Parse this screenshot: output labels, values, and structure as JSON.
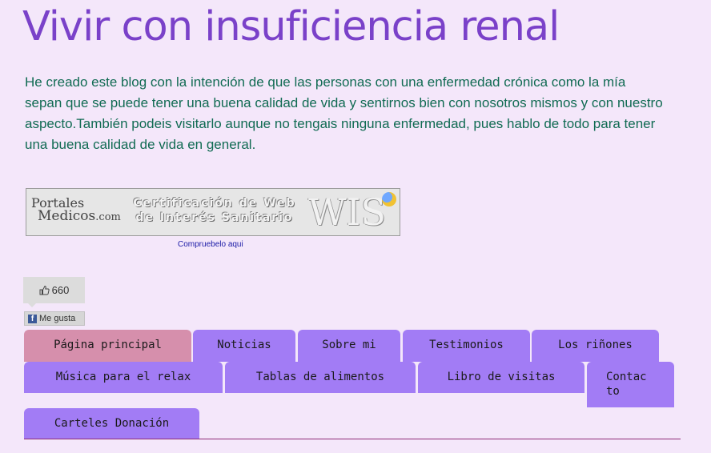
{
  "header": {
    "title": "Vivir con insuficiencia renal"
  },
  "description": "He creado este blog con la intención de que las personas con una enfermedad crónica como la mía sepan que se puede tener una buena calidad de vida y sentirnos bien con nosotros mismos y con nuestro aspecto.También podeis visitarlo aunque no tengais ninguna enfermedad, pues hablo de todo para tener una buena calidad de vida en general.",
  "badge": {
    "logo_line1": "Portales",
    "logo_line2": "Medicos",
    "logo_suffix": ".com",
    "cert_line1": "Certificación de Web",
    "cert_line2": "de Interés Sanitario",
    "wis": "WIS",
    "check_link": "Compruebelo aqui"
  },
  "like": {
    "count": "660",
    "button_label": "Me gusta",
    "fb_letter": "f"
  },
  "nav": {
    "tabs": [
      {
        "label": "Página principal",
        "active": true
      },
      {
        "label": "Noticias"
      },
      {
        "label": "Sobre mi"
      },
      {
        "label": "Testimonios"
      },
      {
        "label": "Los riñones"
      },
      {
        "label": "Música para el relax"
      },
      {
        "label": "Tablas de alimentos"
      },
      {
        "label": "Libro de visitas"
      },
      {
        "label": "Contac to"
      },
      {
        "label": "Carteles Donación"
      }
    ]
  },
  "colors": {
    "background": "#f4e7fa",
    "title": "#7a41c9",
    "text": "#116b53",
    "tab": "#a27cf5",
    "tab_active": "#d68fac"
  }
}
